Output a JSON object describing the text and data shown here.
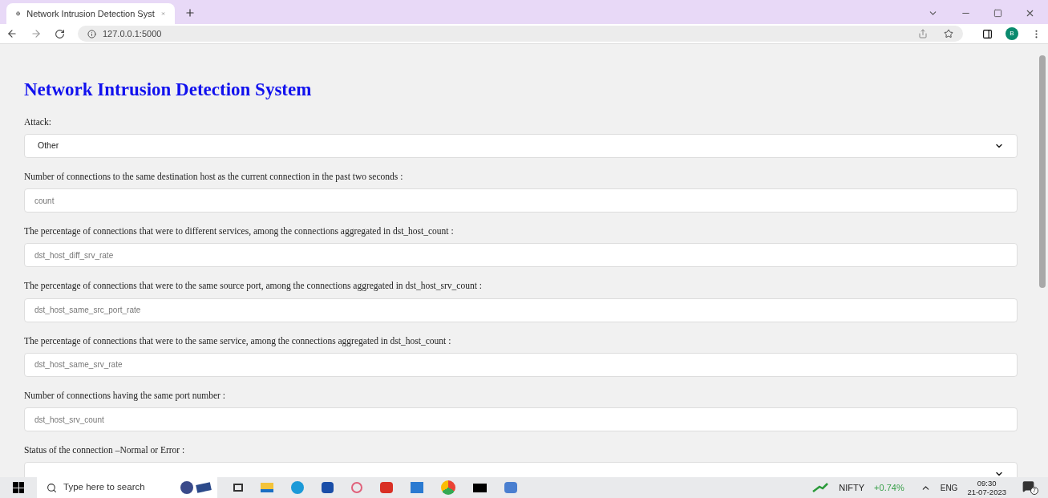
{
  "browser": {
    "tab": {
      "title": "Network Intrusion Detection Syst",
      "selected": true
    },
    "address": "127.0.0.1:5000",
    "profile": "B"
  },
  "page": {
    "title": "Network Intrusion Detection System",
    "fields": [
      {
        "kind": "select",
        "label": "Attack:",
        "value": "Other"
      },
      {
        "kind": "input",
        "label": "Number of connections to the same destination host as the current connection in the past two seconds :",
        "placeholder": "count"
      },
      {
        "kind": "input",
        "label": "The percentage of connections that were to different services, among the connections aggregated in dst_host_count :",
        "placeholder": "dst_host_diff_srv_rate"
      },
      {
        "kind": "input",
        "label": "The percentage of connections that were to the same source port, among the connections aggregated in dst_host_srv_count :",
        "placeholder": "dst_host_same_src_port_rate"
      },
      {
        "kind": "input",
        "label": "The percentage of connections that were to the same service, among the connections aggregated in dst_host_count :",
        "placeholder": "dst_host_same_srv_rate"
      },
      {
        "kind": "input",
        "label": "Number of connections having the same port number :",
        "placeholder": "dst_host_srv_count"
      },
      {
        "kind": "select",
        "label": "Status of the connection –Normal or Error :"
      }
    ]
  },
  "taskbar": {
    "search_placeholder": "Type here to search",
    "ticker": {
      "name": "NIFTY",
      "change": "+0.74%"
    },
    "language": "ENG",
    "time": "09:30",
    "date": "21-07-2023",
    "notifications": "7"
  }
}
